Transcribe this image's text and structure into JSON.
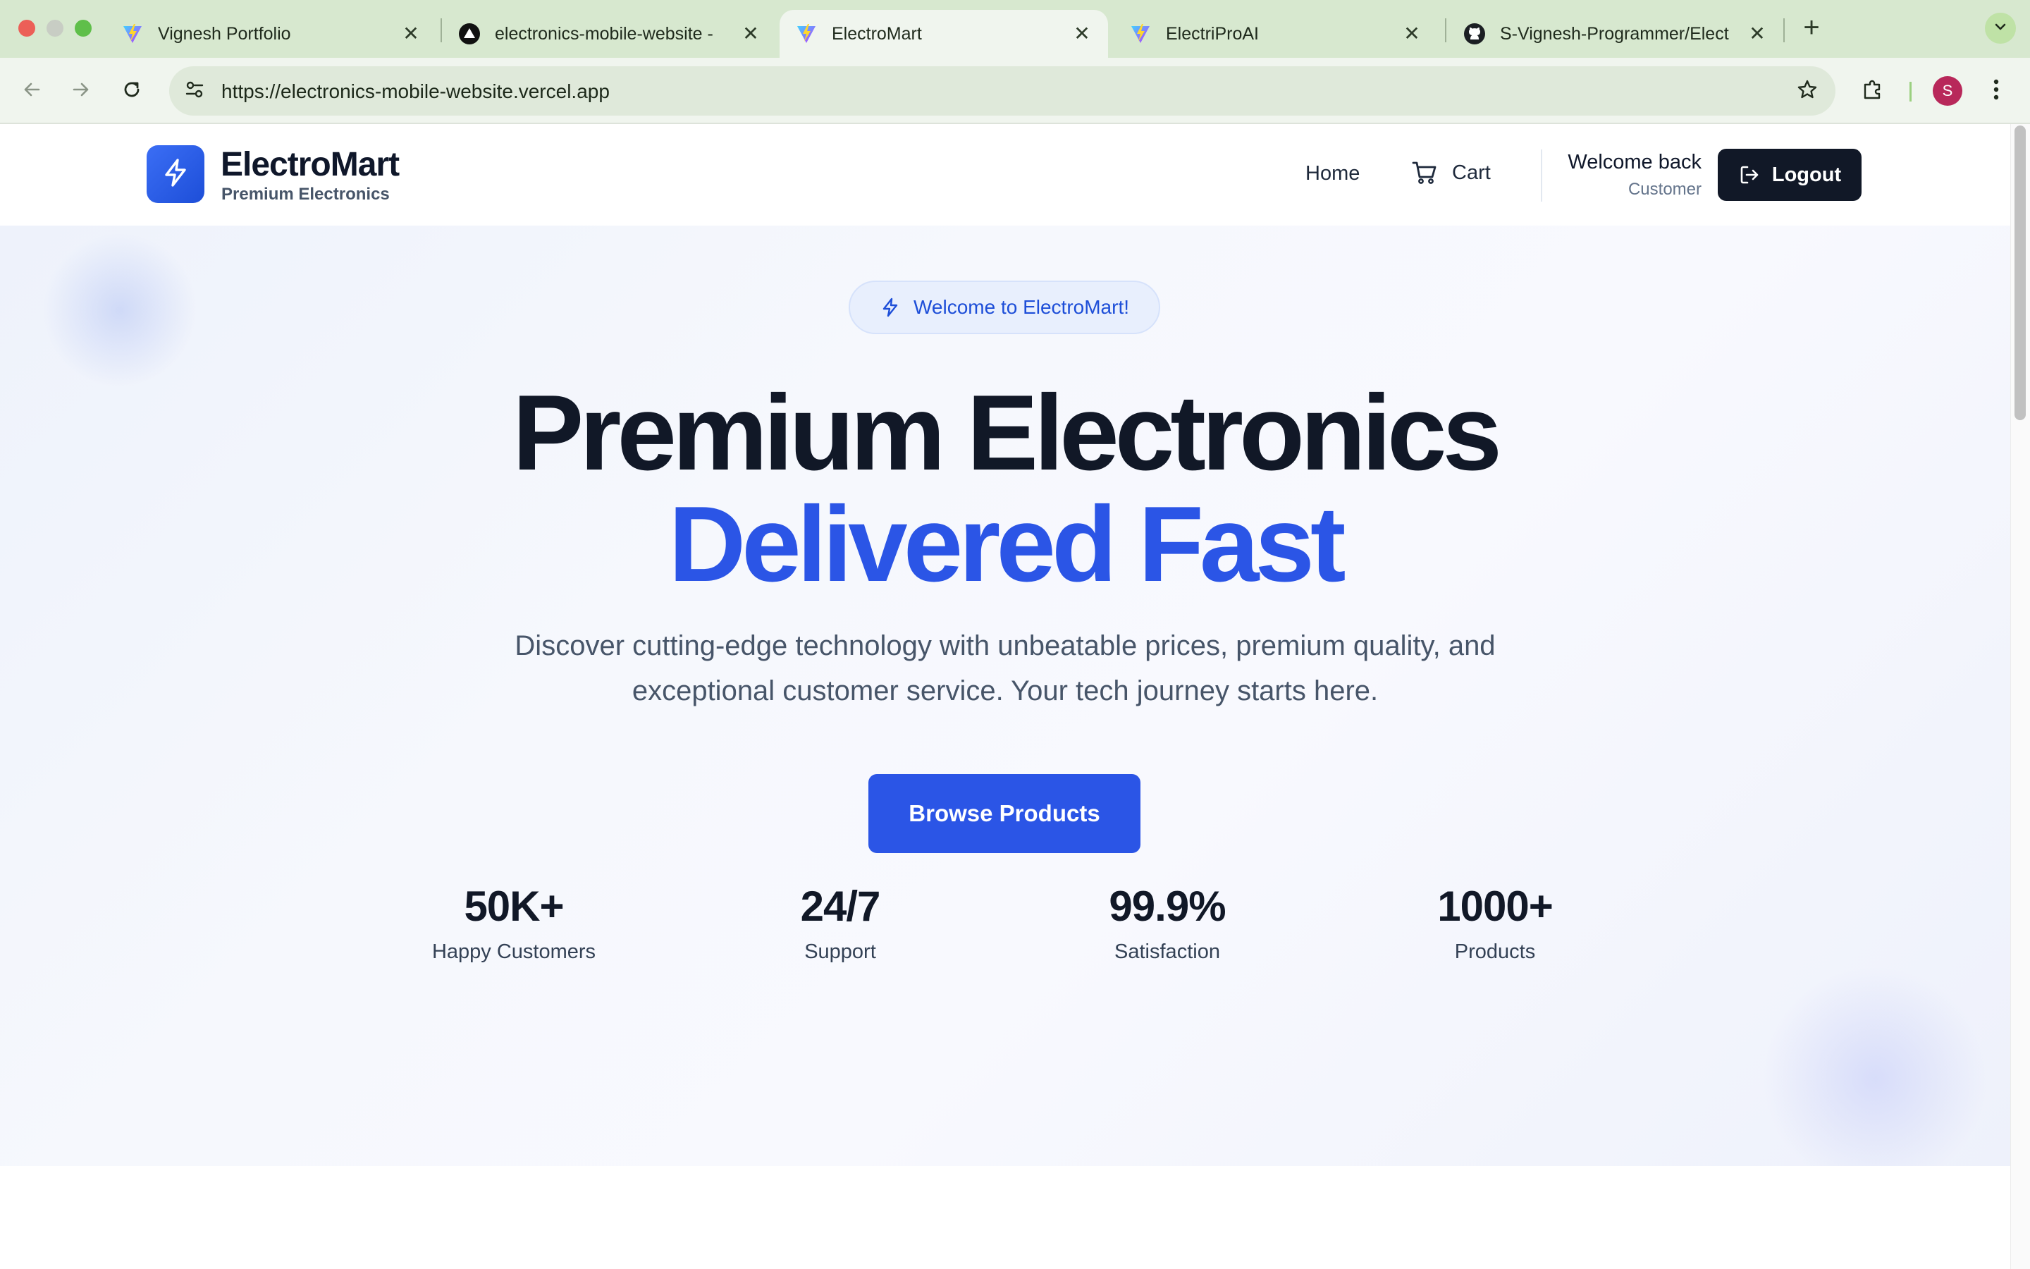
{
  "browser": {
    "tabs": [
      {
        "title": "Vignesh Portfolio",
        "icon": "vite-logo-icon",
        "active": false
      },
      {
        "title": "electronics-mobile-website -",
        "icon": "vercel-logo-icon",
        "active": false
      },
      {
        "title": "ElectroMart",
        "icon": "vite-logo-icon",
        "active": true
      },
      {
        "title": "ElectriProAI",
        "icon": "vite-logo-icon",
        "active": false
      },
      {
        "title": "S-Vignesh-Programmer/Elect",
        "icon": "github-logo-icon",
        "active": false
      }
    ],
    "close_glyph": "✕",
    "new_tab_glyph": "+",
    "url": "https://electronics-mobile-website.vercel.app",
    "profile_initial": "S"
  },
  "header": {
    "brand_name": "ElectroMart",
    "brand_tagline": "Premium Electronics",
    "nav_home": "Home",
    "nav_cart": "Cart",
    "welcome": "Welcome back",
    "role": "Customer",
    "logout": "Logout"
  },
  "hero": {
    "badge": "Welcome to ElectroMart!",
    "headline_line1": "Premium Electronics",
    "headline_line2": "Delivered Fast",
    "subtext": "Discover cutting-edge technology with unbeatable prices, premium quality, and exceptional customer service. Your tech journey starts here.",
    "cta": "Browse Products",
    "stats": [
      {
        "value": "50K+",
        "label": "Happy Customers"
      },
      {
        "value": "24/7",
        "label": "Support"
      },
      {
        "value": "99.9%",
        "label": "Satisfaction"
      },
      {
        "value": "1000+",
        "label": "Products"
      }
    ]
  },
  "colors": {
    "accent": "#2b55e6",
    "dark_button": "#111827",
    "tab_bar": "#d7e8cf"
  }
}
